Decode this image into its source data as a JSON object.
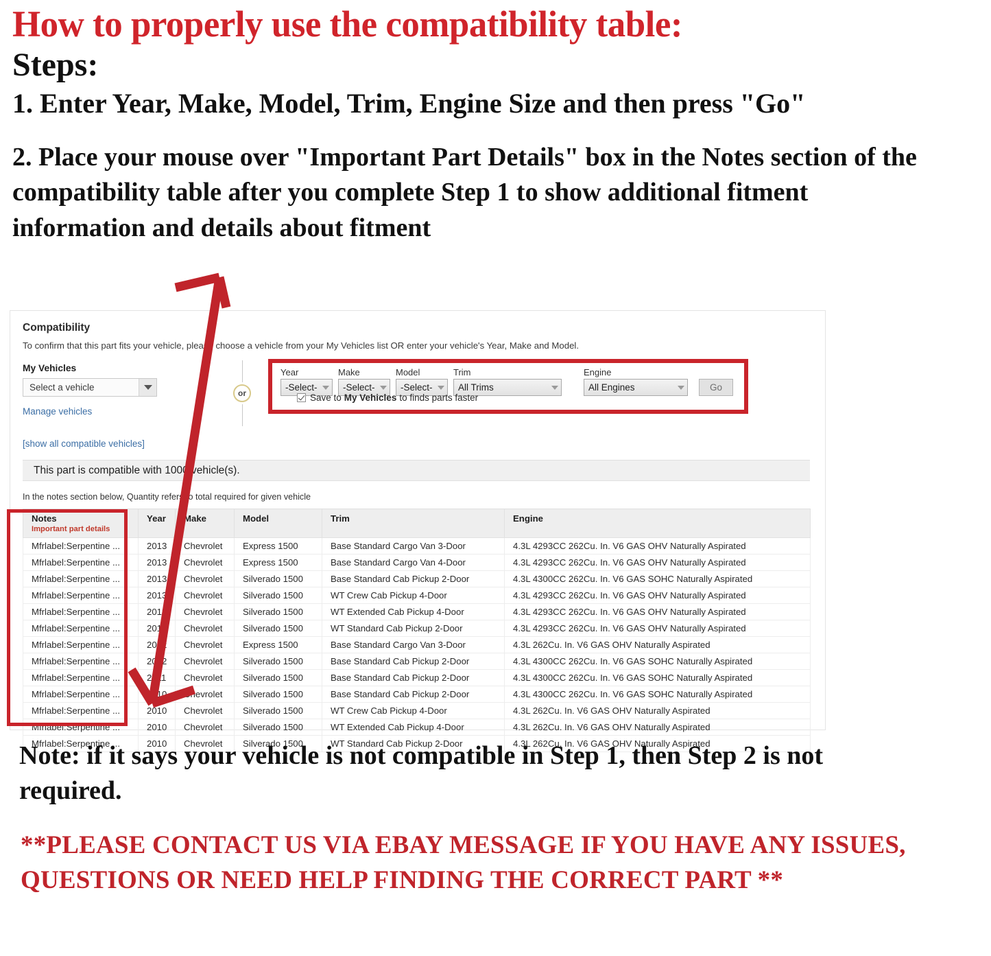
{
  "headline": {
    "title": "How to properly use the compatibility table:",
    "steps_label": "Steps:",
    "step1": "1. Enter Year, Make, Model, Trim, Engine Size and then press \"Go\"",
    "step2": "2. Place your mouse over \"Important Part Details\" box in the Notes section of the compatibility table after you complete Step 1 to show additional fitment information and details about fitment"
  },
  "footer": {
    "note": "Note: if it says your vehicle is not compatible in Step 1, then Step 2 is not required.",
    "contact": "**PLEASE CONTACT US VIA EBAY MESSAGE IF YOU HAVE ANY ISSUES, QUESTIONS OR NEED HELP FINDING THE CORRECT PART **"
  },
  "panel": {
    "title": "Compatibility",
    "subtitle": "To confirm that this part fits your vehicle, please choose a vehicle from your My Vehicles list OR enter your vehicle's Year, Make and Model.",
    "my_vehicles": {
      "label": "My Vehicles",
      "select_value": "Select a vehicle",
      "manage_link": "Manage vehicles"
    },
    "or_label": "or",
    "form": {
      "year": {
        "label": "Year",
        "value": "-Select-"
      },
      "make": {
        "label": "Make",
        "value": "-Select-"
      },
      "model": {
        "label": "Model",
        "value": "-Select-"
      },
      "trim": {
        "label": "Trim",
        "value": "All Trims"
      },
      "engine": {
        "label": "Engine",
        "value": "All Engines"
      },
      "go_label": "Go",
      "save_prefix": "Save to",
      "save_bold": "My Vehicles",
      "save_suffix": "to finds parts faster"
    },
    "show_all_link": "[show all compatible vehicles]",
    "compat_banner": "This part is compatible with 1000 vehicle(s).",
    "notes_hint": "In the notes section below, Quantity refers to total required for given vehicle"
  },
  "table": {
    "headers": {
      "notes": "Notes",
      "notes_sub": "Important part details",
      "year": "Year",
      "make": "Make",
      "model": "Model",
      "trim": "Trim",
      "engine": "Engine"
    },
    "rows": [
      {
        "notes": "Mfrlabel:Serpentine ...",
        "year": "2013",
        "make": "Chevrolet",
        "model": "Express 1500",
        "trim": "Base Standard Cargo Van 3-Door",
        "engine": "4.3L 4293CC 262Cu. In. V6 GAS OHV Naturally Aspirated"
      },
      {
        "notes": "Mfrlabel:Serpentine ...",
        "year": "2013",
        "make": "Chevrolet",
        "model": "Express 1500",
        "trim": "Base Standard Cargo Van 4-Door",
        "engine": "4.3L 4293CC 262Cu. In. V6 GAS OHV Naturally Aspirated"
      },
      {
        "notes": "Mfrlabel:Serpentine ...",
        "year": "2013",
        "make": "Chevrolet",
        "model": "Silverado 1500",
        "trim": "Base Standard Cab Pickup 2-Door",
        "engine": "4.3L 4300CC 262Cu. In. V6 GAS SOHC Naturally Aspirated"
      },
      {
        "notes": "Mfrlabel:Serpentine ...",
        "year": "2013",
        "make": "Chevrolet",
        "model": "Silverado 1500",
        "trim": "WT Crew Cab Pickup 4-Door",
        "engine": "4.3L 4293CC 262Cu. In. V6 GAS OHV Naturally Aspirated"
      },
      {
        "notes": "Mfrlabel:Serpentine ...",
        "year": "2013",
        "make": "Chevrolet",
        "model": "Silverado 1500",
        "trim": "WT Extended Cab Pickup 4-Door",
        "engine": "4.3L 4293CC 262Cu. In. V6 GAS OHV Naturally Aspirated"
      },
      {
        "notes": "Mfrlabel:Serpentine ...",
        "year": "2013",
        "make": "Chevrolet",
        "model": "Silverado 1500",
        "trim": "WT Standard Cab Pickup 2-Door",
        "engine": "4.3L 4293CC 262Cu. In. V6 GAS OHV Naturally Aspirated"
      },
      {
        "notes": "Mfrlabel:Serpentine ...",
        "year": "2012",
        "make": "Chevrolet",
        "model": "Express 1500",
        "trim": "Base Standard Cargo Van 3-Door",
        "engine": "4.3L 262Cu. In. V6 GAS OHV Naturally Aspirated"
      },
      {
        "notes": "Mfrlabel:Serpentine ...",
        "year": "2012",
        "make": "Chevrolet",
        "model": "Silverado 1500",
        "trim": "Base Standard Cab Pickup 2-Door",
        "engine": "4.3L 4300CC 262Cu. In. V6 GAS SOHC Naturally Aspirated"
      },
      {
        "notes": "Mfrlabel:Serpentine ...",
        "year": "2011",
        "make": "Chevrolet",
        "model": "Silverado 1500",
        "trim": "Base Standard Cab Pickup 2-Door",
        "engine": "4.3L 4300CC 262Cu. In. V6 GAS SOHC Naturally Aspirated"
      },
      {
        "notes": "Mfrlabel:Serpentine ...",
        "year": "2010",
        "make": "Chevrolet",
        "model": "Silverado 1500",
        "trim": "Base Standard Cab Pickup 2-Door",
        "engine": "4.3L 4300CC 262Cu. In. V6 GAS SOHC Naturally Aspirated"
      },
      {
        "notes": "Mfrlabel:Serpentine ...",
        "year": "2010",
        "make": "Chevrolet",
        "model": "Silverado 1500",
        "trim": "WT Crew Cab Pickup 4-Door",
        "engine": "4.3L 262Cu. In. V6 GAS OHV Naturally Aspirated"
      },
      {
        "notes": "Mfrlabel:Serpentine ...",
        "year": "2010",
        "make": "Chevrolet",
        "model": "Silverado 1500",
        "trim": "WT Extended Cab Pickup 4-Door",
        "engine": "4.3L 262Cu. In. V6 GAS OHV Naturally Aspirated"
      },
      {
        "notes": "Mfrlabel:Serpentine ...",
        "year": "2010",
        "make": "Chevrolet",
        "model": "Silverado 1500",
        "trim": "WT Standard Cab Pickup 2-Door",
        "engine": "4.3L 262Cu. In. V6 GAS OHV Naturally Aspirated"
      }
    ]
  },
  "colors": {
    "red_heading": "#D0242B",
    "red_box": "#C9242B",
    "link_blue": "#3b6ea5",
    "important_red": "#C0392B"
  }
}
